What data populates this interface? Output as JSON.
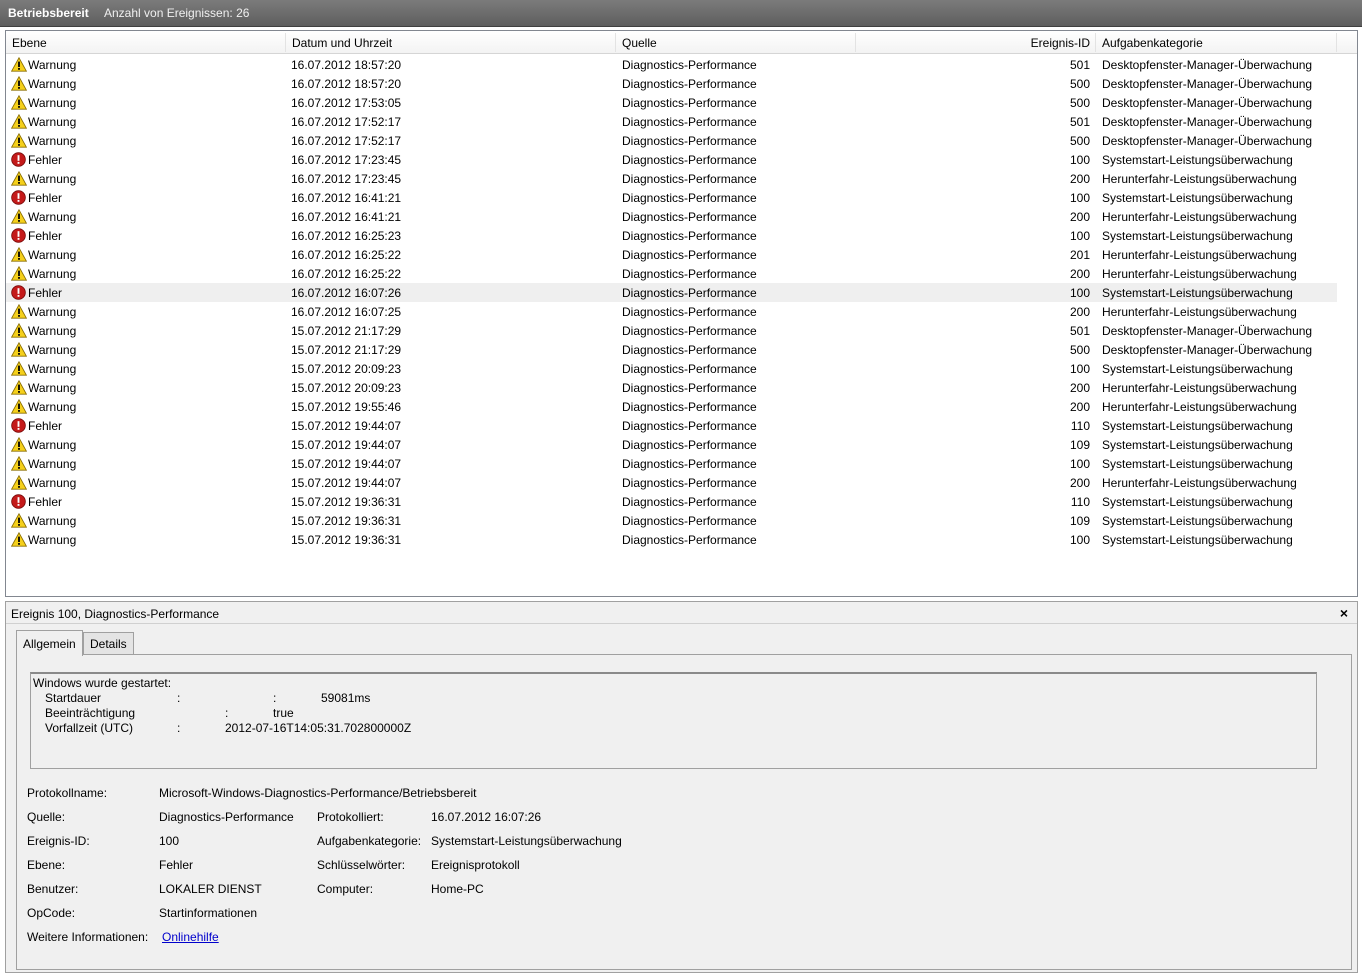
{
  "header": {
    "title": "Betriebsbereit",
    "count_label": "Anzahl von Ereignissen: 26"
  },
  "columns": [
    "Ebene",
    "Datum und Uhrzeit",
    "Quelle",
    "Ereignis-ID",
    "Aufgabenkategorie"
  ],
  "icons": {
    "warning": "warning-icon",
    "error": "error-icon"
  },
  "colors": {
    "warning": "#f5d01b",
    "error": "#c41a1a",
    "link": "#0000cc"
  },
  "events": [
    {
      "level": "Warnung",
      "type": "warning",
      "date": "16.07.2012 18:57:20",
      "source": "Diagnostics-Performance",
      "id": "501",
      "category": "Desktopfenster-Manager-Überwachung"
    },
    {
      "level": "Warnung",
      "type": "warning",
      "date": "16.07.2012 18:57:20",
      "source": "Diagnostics-Performance",
      "id": "500",
      "category": "Desktopfenster-Manager-Überwachung"
    },
    {
      "level": "Warnung",
      "type": "warning",
      "date": "16.07.2012 17:53:05",
      "source": "Diagnostics-Performance",
      "id": "500",
      "category": "Desktopfenster-Manager-Überwachung"
    },
    {
      "level": "Warnung",
      "type": "warning",
      "date": "16.07.2012 17:52:17",
      "source": "Diagnostics-Performance",
      "id": "501",
      "category": "Desktopfenster-Manager-Überwachung"
    },
    {
      "level": "Warnung",
      "type": "warning",
      "date": "16.07.2012 17:52:17",
      "source": "Diagnostics-Performance",
      "id": "500",
      "category": "Desktopfenster-Manager-Überwachung"
    },
    {
      "level": "Fehler",
      "type": "error",
      "date": "16.07.2012 17:23:45",
      "source": "Diagnostics-Performance",
      "id": "100",
      "category": "Systemstart-Leistungsüberwachung"
    },
    {
      "level": "Warnung",
      "type": "warning",
      "date": "16.07.2012 17:23:45",
      "source": "Diagnostics-Performance",
      "id": "200",
      "category": "Herunterfahr-Leistungsüberwachung"
    },
    {
      "level": "Fehler",
      "type": "error",
      "date": "16.07.2012 16:41:21",
      "source": "Diagnostics-Performance",
      "id": "100",
      "category": "Systemstart-Leistungsüberwachung"
    },
    {
      "level": "Warnung",
      "type": "warning",
      "date": "16.07.2012 16:41:21",
      "source": "Diagnostics-Performance",
      "id": "200",
      "category": "Herunterfahr-Leistungsüberwachung"
    },
    {
      "level": "Fehler",
      "type": "error",
      "date": "16.07.2012 16:25:23",
      "source": "Diagnostics-Performance",
      "id": "100",
      "category": "Systemstart-Leistungsüberwachung"
    },
    {
      "level": "Warnung",
      "type": "warning",
      "date": "16.07.2012 16:25:22",
      "source": "Diagnostics-Performance",
      "id": "201",
      "category": "Herunterfahr-Leistungsüberwachung"
    },
    {
      "level": "Warnung",
      "type": "warning",
      "date": "16.07.2012 16:25:22",
      "source": "Diagnostics-Performance",
      "id": "200",
      "category": "Herunterfahr-Leistungsüberwachung"
    },
    {
      "level": "Fehler",
      "type": "error",
      "date": "16.07.2012 16:07:26",
      "source": "Diagnostics-Performance",
      "id": "100",
      "category": "Systemstart-Leistungsüberwachung",
      "selected": true
    },
    {
      "level": "Warnung",
      "type": "warning",
      "date": "16.07.2012 16:07:25",
      "source": "Diagnostics-Performance",
      "id": "200",
      "category": "Herunterfahr-Leistungsüberwachung"
    },
    {
      "level": "Warnung",
      "type": "warning",
      "date": "15.07.2012 21:17:29",
      "source": "Diagnostics-Performance",
      "id": "501",
      "category": "Desktopfenster-Manager-Überwachung"
    },
    {
      "level": "Warnung",
      "type": "warning",
      "date": "15.07.2012 21:17:29",
      "source": "Diagnostics-Performance",
      "id": "500",
      "category": "Desktopfenster-Manager-Überwachung"
    },
    {
      "level": "Warnung",
      "type": "warning",
      "date": "15.07.2012 20:09:23",
      "source": "Diagnostics-Performance",
      "id": "100",
      "category": "Systemstart-Leistungsüberwachung"
    },
    {
      "level": "Warnung",
      "type": "warning",
      "date": "15.07.2012 20:09:23",
      "source": "Diagnostics-Performance",
      "id": "200",
      "category": "Herunterfahr-Leistungsüberwachung"
    },
    {
      "level": "Warnung",
      "type": "warning",
      "date": "15.07.2012 19:55:46",
      "source": "Diagnostics-Performance",
      "id": "200",
      "category": "Herunterfahr-Leistungsüberwachung"
    },
    {
      "level": "Fehler",
      "type": "error",
      "date": "15.07.2012 19:44:07",
      "source": "Diagnostics-Performance",
      "id": "110",
      "category": "Systemstart-Leistungsüberwachung"
    },
    {
      "level": "Warnung",
      "type": "warning",
      "date": "15.07.2012 19:44:07",
      "source": "Diagnostics-Performance",
      "id": "109",
      "category": "Systemstart-Leistungsüberwachung"
    },
    {
      "level": "Warnung",
      "type": "warning",
      "date": "15.07.2012 19:44:07",
      "source": "Diagnostics-Performance",
      "id": "100",
      "category": "Systemstart-Leistungsüberwachung"
    },
    {
      "level": "Warnung",
      "type": "warning",
      "date": "15.07.2012 19:44:07",
      "source": "Diagnostics-Performance",
      "id": "200",
      "category": "Herunterfahr-Leistungsüberwachung"
    },
    {
      "level": "Fehler",
      "type": "error",
      "date": "15.07.2012 19:36:31",
      "source": "Diagnostics-Performance",
      "id": "110",
      "category": "Systemstart-Leistungsüberwachung"
    },
    {
      "level": "Warnung",
      "type": "warning",
      "date": "15.07.2012 19:36:31",
      "source": "Diagnostics-Performance",
      "id": "109",
      "category": "Systemstart-Leistungsüberwachung"
    },
    {
      "level": "Warnung",
      "type": "warning",
      "date": "15.07.2012 19:36:31",
      "source": "Diagnostics-Performance",
      "id": "100",
      "category": "Systemstart-Leistungsüberwachung"
    }
  ],
  "detail": {
    "title": "Ereignis 100, Diagnostics-Performance",
    "close_label": "×",
    "tabs": {
      "general": "Allgemein",
      "details": "Details"
    },
    "description": {
      "line1": "Windows wurde gestartet:",
      "startdauer_label": "Startdauer",
      "colon": ":",
      "startdauer_value": "59081ms",
      "beeintr_label": "Beeinträchtigung",
      "beeintr_value": "true",
      "vorfall_label": "Vorfallzeit (UTC)",
      "vorfall_value": "2012-07-16T14:05:31.702800000Z"
    },
    "fields": {
      "protokollname_label": "Protokollname:",
      "protokollname_value": "Microsoft-Windows-Diagnostics-Performance/Betriebsbereit",
      "quelle_label": "Quelle:",
      "quelle_value": "Diagnostics-Performance",
      "protokolliert_label": "Protokolliert:",
      "protokolliert_value": "16.07.2012 16:07:26",
      "eid_label": "Ereignis-ID:",
      "eid_value": "100",
      "kategorie_label": "Aufgabenkategorie:",
      "kategorie_value": "Systemstart-Leistungsüberwachung",
      "ebene_label": "Ebene:",
      "ebene_value": "Fehler",
      "schluessel_label": "Schlüsselwörter:",
      "schluessel_value": "Ereignisprotokoll",
      "benutzer_label": "Benutzer:",
      "benutzer_value": "LOKALER DIENST",
      "computer_label": "Computer:",
      "computer_value": "Home-PC",
      "opcode_label": "OpCode:",
      "opcode_value": "Startinformationen",
      "weitere_label": "Weitere Informationen:",
      "weitere_link": "Onlinehilfe"
    }
  }
}
